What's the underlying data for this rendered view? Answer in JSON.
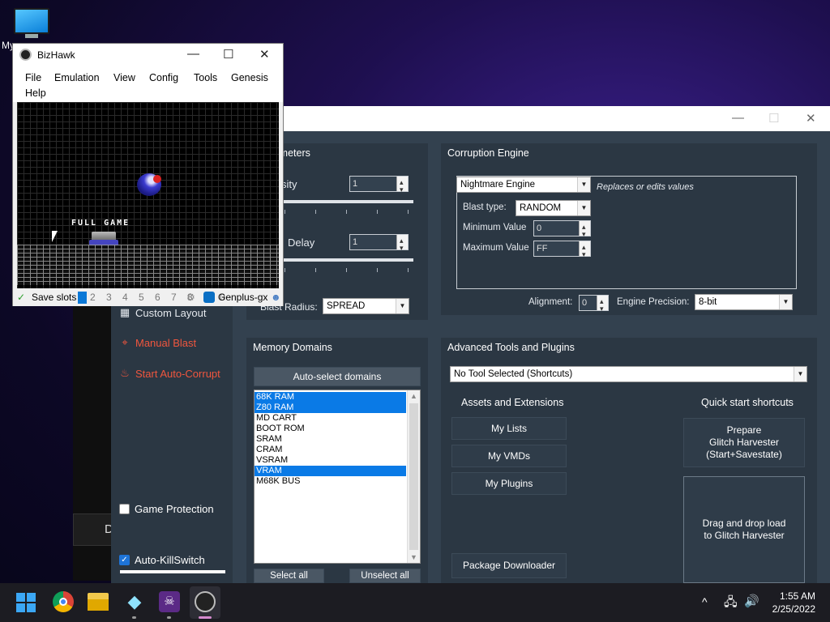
{
  "desktop": {
    "icon_label": "My"
  },
  "bg_window": {
    "button_label": "D"
  },
  "rtc": {
    "titlebar": {
      "minimize": "—",
      "maximize": "☐",
      "close": "✕"
    },
    "sidebar": {
      "custom_layout": "Custom Layout",
      "manual_blast": "Manual Blast",
      "auto_corrupt": "Start Auto-Corrupt",
      "game_protection": "Game Protection",
      "auto_killswitch": "Auto-KillSwitch"
    },
    "general": {
      "title": "l Parameters",
      "intensity_label": "sity",
      "intensity_value": "1",
      "delay_label": "Delay",
      "delay_value": "1",
      "blast_radius_label": "Blast Radius:",
      "blast_radius_value": "SPREAD"
    },
    "engine": {
      "title": "Corruption Engine",
      "engine_value": "Nightmare Engine",
      "engine_desc": "Replaces or edits values",
      "blast_type_label": "Blast type:",
      "blast_type_value": "RANDOM",
      "min_label": "Minimum Value",
      "min_value": "0",
      "max_label": "Maximum Value",
      "max_value": "FF",
      "alignment_label": "Alignment:",
      "alignment_value": "0",
      "precision_label": "Engine Precision:",
      "precision_value": "8-bit"
    },
    "memory": {
      "title": "Memory Domains",
      "auto_select": "Auto-select domains",
      "domains": [
        {
          "name": "68K RAM",
          "selected": true
        },
        {
          "name": "Z80 RAM",
          "selected": true
        },
        {
          "name": "MD CART",
          "selected": false
        },
        {
          "name": "BOOT ROM",
          "selected": false
        },
        {
          "name": "SRAM",
          "selected": false
        },
        {
          "name": "CRAM",
          "selected": false
        },
        {
          "name": "VSRAM",
          "selected": false
        },
        {
          "name": "VRAM",
          "selected": true
        },
        {
          "name": "M68K BUS",
          "selected": false
        }
      ],
      "select_all": "Select all",
      "unselect_all": "Unselect all"
    },
    "tools": {
      "title": "Advanced Tools and Plugins",
      "tool_select": "No Tool Selected (Shortcuts)",
      "assets_title": "Assets and Extensions",
      "my_lists": "My Lists",
      "my_vmds": "My VMDs",
      "my_plugins": "My Plugins",
      "package_downloader": "Package Downloader",
      "quick_title": "Quick start shortcuts",
      "prepare_line1": "Prepare",
      "prepare_line2": "Glitch Harvester",
      "prepare_line3": "(Start+Savestate)",
      "drag_line1": "Drag and drop load",
      "drag_line2": "to Glitch Harvester"
    }
  },
  "bizhawk": {
    "title": "BizHawk",
    "minimize": "—",
    "maximize": "☐",
    "close": "✕",
    "menu": [
      "File",
      "Emulation",
      "View",
      "Config",
      "Tools",
      "Genesis",
      "Help"
    ],
    "game_text": "FULL GAME",
    "save_slots": "Save slots",
    "slot_selected": "1",
    "slot_nums": "2 3 4 5 6 7 8 9 0",
    "core": "Genplus-gx"
  },
  "taskbar": {
    "time": "1:55 AM",
    "date": "2/25/2022",
    "tray_chevron": "^"
  }
}
